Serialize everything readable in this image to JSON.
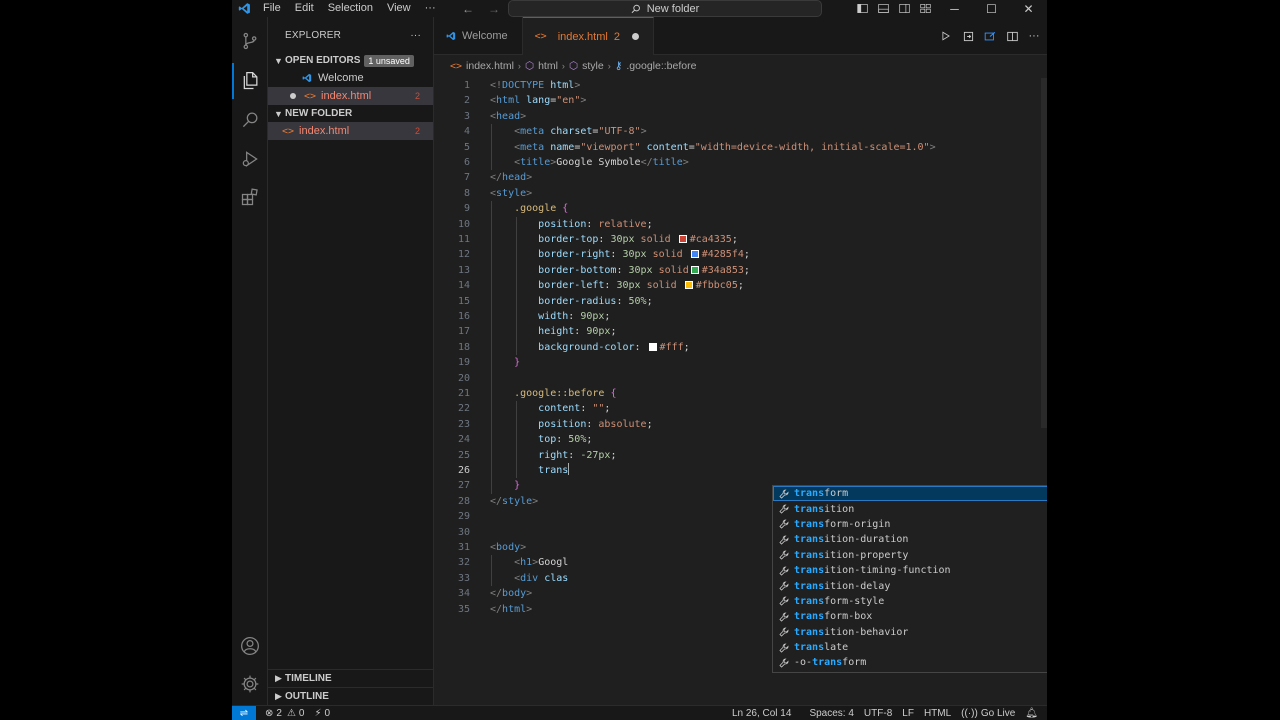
{
  "titlebar": {
    "menus": [
      "File",
      "Edit",
      "Selection",
      "View"
    ],
    "more": "···",
    "search_text": "New folder",
    "window_controls": [
      "minimize",
      "maximize",
      "close"
    ]
  },
  "sidebar": {
    "title": "EXPLORER",
    "more": "···",
    "open_editors": {
      "label": "OPEN EDITORS",
      "badge": "1 unsaved",
      "items": [
        {
          "name": "Welcome",
          "count": ""
        },
        {
          "name": "index.html",
          "count": "2"
        }
      ]
    },
    "folder": {
      "label": "NEW FOLDER",
      "items": [
        {
          "name": "index.html",
          "count": "2"
        }
      ]
    },
    "timeline": "TIMELINE",
    "outline": "OUTLINE"
  },
  "tabs": [
    {
      "label": "Welcome",
      "count": ""
    },
    {
      "label": "index.html",
      "count": "2"
    }
  ],
  "breadcrumb": [
    "index.html",
    "html",
    "style",
    ".google::before"
  ],
  "code_lines": [
    {
      "n": "1",
      "segs": [
        [
          "t-br",
          "<!"
        ],
        [
          "t-tag",
          "DOCTYPE"
        ],
        [
          "t-attr",
          " html"
        ],
        [
          "t-br",
          ">"
        ]
      ]
    },
    {
      "n": "2",
      "segs": [
        [
          "t-br",
          "<"
        ],
        [
          "t-tag",
          "html"
        ],
        [
          "t-attr",
          " lang"
        ],
        [
          "t-txt",
          "="
        ],
        [
          "t-str",
          "\"en\""
        ],
        [
          "t-br",
          ">"
        ]
      ]
    },
    {
      "n": "3",
      "segs": [
        [
          "t-br",
          "<"
        ],
        [
          "t-tag",
          "head"
        ],
        [
          "t-br",
          ">"
        ]
      ]
    },
    {
      "n": "4",
      "segs": [
        [
          "t-txt",
          "    "
        ],
        [
          "t-br",
          "<"
        ],
        [
          "t-tag",
          "meta"
        ],
        [
          "t-attr",
          " charset"
        ],
        [
          "t-txt",
          "="
        ],
        [
          "t-str",
          "\"UTF-8\""
        ],
        [
          "t-br",
          ">"
        ]
      ]
    },
    {
      "n": "5",
      "segs": [
        [
          "t-txt",
          "    "
        ],
        [
          "t-br",
          "<"
        ],
        [
          "t-tag",
          "meta"
        ],
        [
          "t-attr",
          " name"
        ],
        [
          "t-txt",
          "="
        ],
        [
          "t-str",
          "\"viewport\""
        ],
        [
          "t-attr",
          " content"
        ],
        [
          "t-txt",
          "="
        ],
        [
          "t-str",
          "\"width=device-width, initial-scale=1.0\""
        ],
        [
          "t-br",
          ">"
        ]
      ]
    },
    {
      "n": "6",
      "segs": [
        [
          "t-txt",
          "    "
        ],
        [
          "t-br",
          "<"
        ],
        [
          "t-tag",
          "title"
        ],
        [
          "t-br",
          ">"
        ],
        [
          "t-txt",
          "Google Symbole"
        ],
        [
          "t-br",
          "</"
        ],
        [
          "t-tag",
          "title"
        ],
        [
          "t-br",
          ">"
        ]
      ]
    },
    {
      "n": "7",
      "segs": [
        [
          "t-br",
          "</"
        ],
        [
          "t-tag",
          "head"
        ],
        [
          "t-br",
          ">"
        ]
      ]
    },
    {
      "n": "8",
      "segs": [
        [
          "t-br",
          "<"
        ],
        [
          "t-tag",
          "style"
        ],
        [
          "t-br",
          ">"
        ]
      ]
    },
    {
      "n": "9",
      "segs": [
        [
          "t-txt",
          "    "
        ],
        [
          "t-sel",
          ".google"
        ],
        [
          "t-txt",
          " "
        ],
        [
          "t-brace",
          "{"
        ]
      ]
    },
    {
      "n": "10",
      "segs": [
        [
          "t-txt",
          "        "
        ],
        [
          "t-prop",
          "position"
        ],
        [
          "t-txt",
          ": "
        ],
        [
          "t-val",
          "relative"
        ],
        [
          "t-txt",
          ";"
        ]
      ]
    },
    {
      "n": "11",
      "segs": [
        [
          "t-txt",
          "        "
        ],
        [
          "t-prop",
          "border-top"
        ],
        [
          "t-txt",
          ": "
        ],
        [
          "t-num",
          "30px"
        ],
        [
          "t-val",
          " solid "
        ],
        [
          "swatch",
          "#ca4335"
        ],
        [
          "t-val",
          "#ca4335"
        ],
        [
          "t-txt",
          ";"
        ]
      ]
    },
    {
      "n": "12",
      "segs": [
        [
          "t-txt",
          "        "
        ],
        [
          "t-prop",
          "border-right"
        ],
        [
          "t-txt",
          ": "
        ],
        [
          "t-num",
          "30px"
        ],
        [
          "t-val",
          " solid "
        ],
        [
          "swatch",
          "#4285f4"
        ],
        [
          "t-val",
          "#4285f4"
        ],
        [
          "t-txt",
          ";"
        ]
      ]
    },
    {
      "n": "13",
      "segs": [
        [
          "t-txt",
          "        "
        ],
        [
          "t-prop",
          "border-bottom"
        ],
        [
          "t-txt",
          ": "
        ],
        [
          "t-num",
          "30px"
        ],
        [
          "t-val",
          " solid"
        ],
        [
          "swatch",
          "#34a853"
        ],
        [
          "t-val",
          "#34a853"
        ],
        [
          "t-txt",
          ";"
        ]
      ]
    },
    {
      "n": "14",
      "segs": [
        [
          "t-txt",
          "        "
        ],
        [
          "t-prop",
          "border-left"
        ],
        [
          "t-txt",
          ": "
        ],
        [
          "t-num",
          "30px"
        ],
        [
          "t-val",
          " solid "
        ],
        [
          "swatch",
          "#fbbc05"
        ],
        [
          "t-val",
          "#fbbc05"
        ],
        [
          "t-txt",
          ";"
        ]
      ]
    },
    {
      "n": "15",
      "segs": [
        [
          "t-txt",
          "        "
        ],
        [
          "t-prop",
          "border-radius"
        ],
        [
          "t-txt",
          ": "
        ],
        [
          "t-num",
          "50%"
        ],
        [
          "t-txt",
          ";"
        ]
      ]
    },
    {
      "n": "16",
      "segs": [
        [
          "t-txt",
          "        "
        ],
        [
          "t-prop",
          "width"
        ],
        [
          "t-txt",
          ": "
        ],
        [
          "t-num",
          "90px"
        ],
        [
          "t-txt",
          ";"
        ]
      ]
    },
    {
      "n": "17",
      "segs": [
        [
          "t-txt",
          "        "
        ],
        [
          "t-prop",
          "height"
        ],
        [
          "t-txt",
          ": "
        ],
        [
          "t-num",
          "90px"
        ],
        [
          "t-txt",
          ";"
        ]
      ]
    },
    {
      "n": "18",
      "segs": [
        [
          "t-txt",
          "        "
        ],
        [
          "t-prop",
          "background-color"
        ],
        [
          "t-txt",
          ": "
        ],
        [
          "swatch",
          "#ffffff"
        ],
        [
          "t-val",
          "#fff"
        ],
        [
          "t-txt",
          ";"
        ]
      ]
    },
    {
      "n": "19",
      "segs": [
        [
          "t-txt",
          "    "
        ],
        [
          "t-brace",
          "}"
        ]
      ]
    },
    {
      "n": "20",
      "segs": []
    },
    {
      "n": "21",
      "segs": [
        [
          "t-txt",
          "    "
        ],
        [
          "t-sel",
          ".google::before"
        ],
        [
          "t-txt",
          " "
        ],
        [
          "t-brace",
          "{"
        ]
      ]
    },
    {
      "n": "22",
      "segs": [
        [
          "t-txt",
          "        "
        ],
        [
          "t-prop",
          "content"
        ],
        [
          "t-txt",
          ": "
        ],
        [
          "t-val",
          "\"\""
        ],
        [
          "t-txt",
          ";"
        ]
      ]
    },
    {
      "n": "23",
      "segs": [
        [
          "t-txt",
          "        "
        ],
        [
          "t-prop",
          "position"
        ],
        [
          "t-txt",
          ": "
        ],
        [
          "t-val",
          "absolute"
        ],
        [
          "t-txt",
          ";"
        ]
      ]
    },
    {
      "n": "24",
      "segs": [
        [
          "t-txt",
          "        "
        ],
        [
          "t-prop",
          "top"
        ],
        [
          "t-txt",
          ": "
        ],
        [
          "t-num",
          "50%"
        ],
        [
          "t-txt",
          ";"
        ]
      ]
    },
    {
      "n": "25",
      "segs": [
        [
          "t-txt",
          "        "
        ],
        [
          "t-prop",
          "right"
        ],
        [
          "t-txt",
          ": "
        ],
        [
          "t-num",
          "-27px"
        ],
        [
          "t-txt",
          ";"
        ]
      ]
    },
    {
      "n": "26",
      "segs": [
        [
          "t-txt",
          "        "
        ],
        [
          "t-prop",
          "trans"
        ],
        [
          "cursor",
          ""
        ]
      ]
    },
    {
      "n": "27",
      "segs": [
        [
          "t-txt",
          "    "
        ],
        [
          "t-brace",
          "}"
        ]
      ]
    },
    {
      "n": "28",
      "segs": [
        [
          "t-br",
          "</"
        ],
        [
          "t-tag",
          "style"
        ],
        [
          "t-br",
          ">"
        ]
      ]
    },
    {
      "n": "29",
      "segs": []
    },
    {
      "n": "30",
      "segs": []
    },
    {
      "n": "31",
      "segs": [
        [
          "t-br",
          "<"
        ],
        [
          "t-tag",
          "body"
        ],
        [
          "t-br",
          ">"
        ]
      ]
    },
    {
      "n": "32",
      "segs": [
        [
          "t-txt",
          "    "
        ],
        [
          "t-br",
          "<"
        ],
        [
          "t-tag",
          "h1"
        ],
        [
          "t-br",
          ">"
        ],
        [
          "t-txt",
          "Googl"
        ]
      ]
    },
    {
      "n": "33",
      "segs": [
        [
          "t-txt",
          "    "
        ],
        [
          "t-br",
          "<"
        ],
        [
          "t-tag",
          "div"
        ],
        [
          "t-attr",
          " clas"
        ]
      ]
    },
    {
      "n": "34",
      "segs": [
        [
          "t-br",
          "</"
        ],
        [
          "t-tag",
          "body"
        ],
        [
          "t-br",
          ">"
        ]
      ]
    },
    {
      "n": "35",
      "segs": [
        [
          "t-br",
          "</"
        ],
        [
          "t-tag",
          "html"
        ],
        [
          "t-br",
          ">"
        ]
      ]
    }
  ],
  "current_line": "26",
  "suggestions": {
    "typed": "trans",
    "items": [
      "transform",
      "transition",
      "transform-origin",
      "transition-duration",
      "transition-property",
      "transition-timing-function",
      "transition-delay",
      "transform-style",
      "transform-box",
      "transition-behavior",
      "translate",
      "-o-transform"
    ]
  },
  "statusbar": {
    "errors": "2",
    "warnings": "0",
    "ports": "0",
    "position": "Ln 26, Col 14",
    "spaces": "Spaces: 4",
    "encoding": "UTF-8",
    "eol": "LF",
    "language": "HTML",
    "golive": "Go Live"
  },
  "colors": {
    "accent": "#0078d4",
    "html_icon": "#e37933",
    "error": "#c74e39"
  }
}
